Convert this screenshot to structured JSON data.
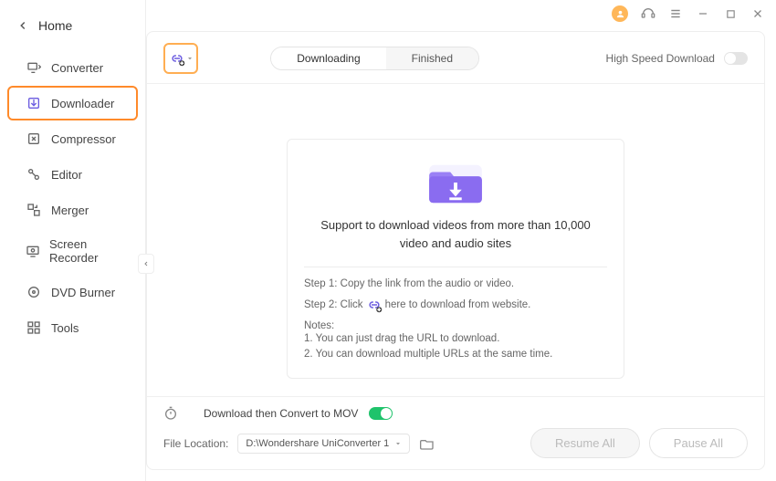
{
  "home": {
    "label": "Home"
  },
  "sidebar": {
    "items": [
      {
        "label": "Converter"
      },
      {
        "label": "Downloader"
      },
      {
        "label": "Compressor"
      },
      {
        "label": "Editor"
      },
      {
        "label": "Merger"
      },
      {
        "label": "Screen Recorder"
      },
      {
        "label": "DVD Burner"
      },
      {
        "label": "Tools"
      }
    ]
  },
  "tabs": {
    "downloading": "Downloading",
    "finished": "Finished"
  },
  "hsd": {
    "label": "High Speed Download"
  },
  "card": {
    "support": "Support to download videos from more than 10,000 video and audio sites",
    "step1": "Step 1: Copy the link from the audio or video.",
    "step2_a": "Step 2: Click",
    "step2_b": "here to download from website.",
    "notes_h": "Notes:",
    "note1": "1. You can just drag the URL to download.",
    "note2": "2. You can download multiple URLs at the same time."
  },
  "bottom": {
    "convert_label": "Download then Convert to MOV",
    "location_label": "File Location:",
    "location_value": "D:\\Wondershare UniConverter 1",
    "resume": "Resume All",
    "pause": "Pause All"
  }
}
